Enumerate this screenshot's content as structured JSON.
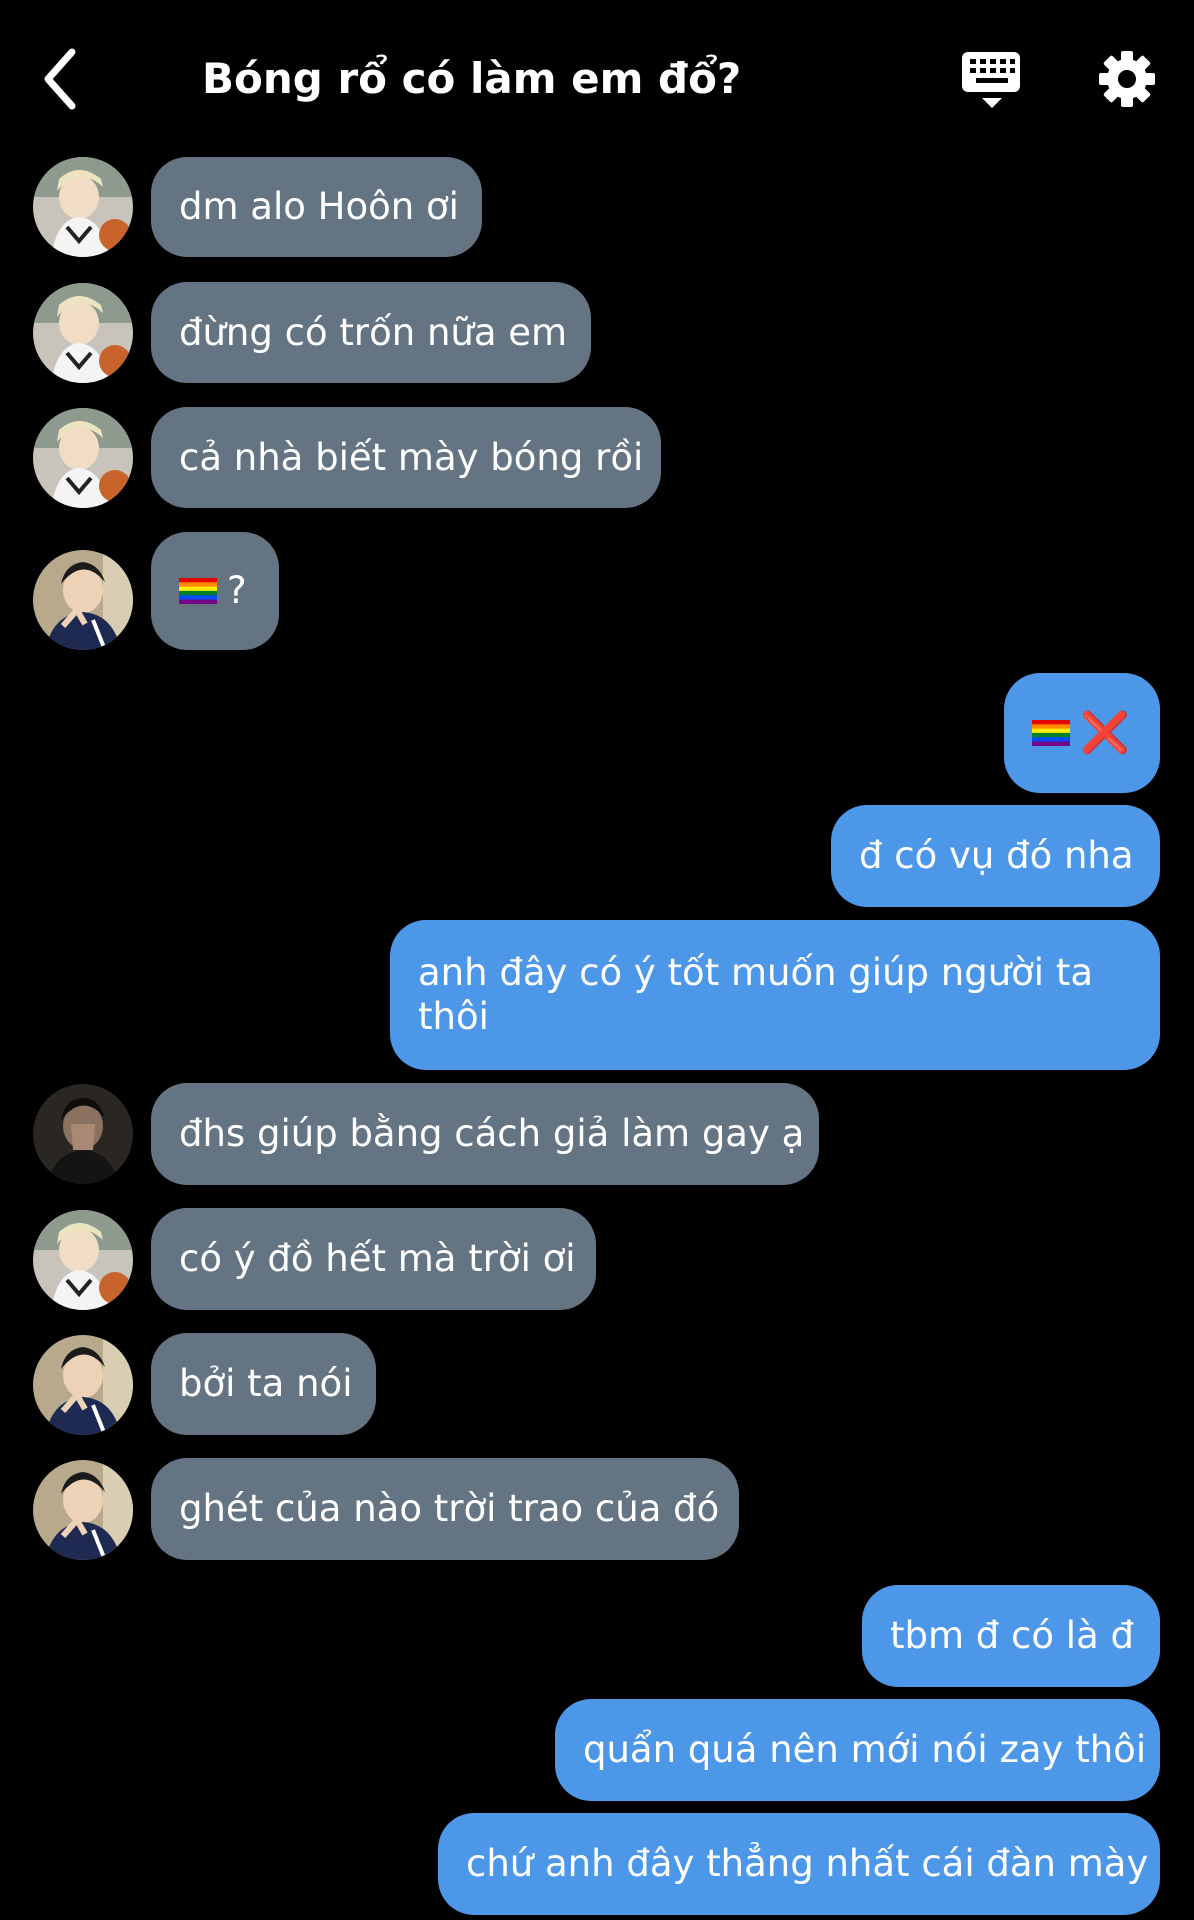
{
  "header": {
    "title": "Bóng rổ có làm em đổ?"
  },
  "colors": {
    "incoming_bubble": "#657483",
    "outgoing_bubble": "#4d97e9",
    "background": "#000000"
  },
  "messages": [
    {
      "side": "in",
      "avatar": "blond-boy-basketball",
      "text": "dm alo Hoôn ơi"
    },
    {
      "side": "in",
      "avatar": "blond-boy-basketball",
      "text": "đừng có trốn nữa em"
    },
    {
      "side": "in",
      "avatar": "blond-boy-basketball",
      "text": "cả nhà biết mày bóng rồi"
    },
    {
      "side": "in",
      "avatar": "dark-hair-boy-peace",
      "text": "?",
      "emoji": "rainbow-flag"
    },
    {
      "side": "out",
      "text": "❌",
      "emoji": "rainbow-flag"
    },
    {
      "side": "out",
      "text": "đ có vụ đó nha"
    },
    {
      "side": "out",
      "text": "anh đây có ý tốt muốn giúp người ta thôi"
    },
    {
      "side": "in",
      "avatar": "dark-boy-covering-face",
      "text": "đhs giúp bằng cách giả làm gay ạ"
    },
    {
      "side": "in",
      "avatar": "blond-boy-basketball",
      "text": "có ý đồ hết mà trời ơi"
    },
    {
      "side": "in",
      "avatar": "dark-hair-boy-peace",
      "text": "bởi ta nói"
    },
    {
      "side": "in",
      "avatar": "dark-hair-boy-peace",
      "text": "ghét của nào trời trao của đó"
    },
    {
      "side": "out",
      "text": "tbm đ có là đ"
    },
    {
      "side": "out",
      "text": "quẩn quá nên mới nói zay thôi"
    },
    {
      "side": "out",
      "text": "chứ anh đây thẳng nhất cái đàn mày"
    }
  ]
}
